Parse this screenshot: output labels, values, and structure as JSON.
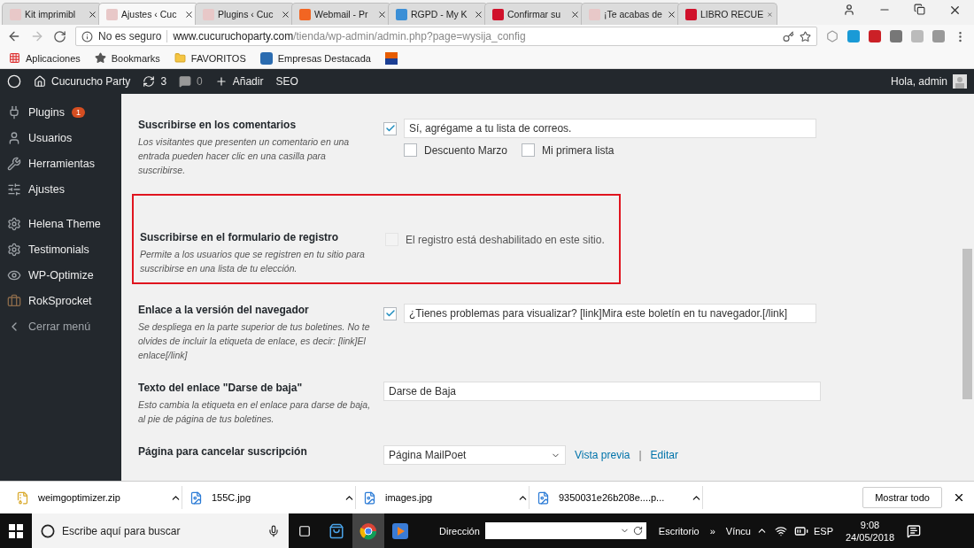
{
  "browser": {
    "tabs": [
      {
        "title": "Kit imprimibl",
        "selected": false,
        "color": "#e8c8c8"
      },
      {
        "title": "Ajustes ‹ Cuc",
        "selected": true,
        "color": "#e8c8c8"
      },
      {
        "title": "Plugins ‹ Cuc",
        "selected": false,
        "color": "#e8c8c8"
      },
      {
        "title": "Webmail - Pr",
        "selected": false,
        "color": "#f26522"
      },
      {
        "title": "RGPD - My K",
        "selected": false,
        "color": "#3b8fd6"
      },
      {
        "title": "Confirmar su",
        "selected": false,
        "color": "#d0112b"
      },
      {
        "title": "¡Te acabas de",
        "selected": false,
        "color": "#e8c8c8"
      },
      {
        "title": "LIBRO RECUE",
        "selected": false,
        "color": "#d0112b"
      }
    ],
    "security": "No es seguro",
    "url_host": "www.cucuruchoparty.com",
    "url_path": "/tienda/wp-admin/admin.php?page=wysija_config",
    "bookmarks": [
      {
        "label": "Aplicaciones",
        "kind": "apps"
      },
      {
        "label": "Bookmarks",
        "kind": "star"
      },
      {
        "label": "FAVORITOS",
        "kind": "folder"
      },
      {
        "label": "Empresas Destacada",
        "kind": "site"
      },
      {
        "kind": "flag"
      }
    ]
  },
  "admin_bar": {
    "site": "Cucurucho Party",
    "updates": "3",
    "comments": "0",
    "new": "Añadir",
    "seo": "SEO",
    "greeting": "Hola, admin"
  },
  "sidebar": {
    "items": [
      {
        "label": "Plugins",
        "badge": "1",
        "kind": "plug"
      },
      {
        "label": "Usuarios",
        "kind": "user"
      },
      {
        "label": "Herramientas",
        "kind": "wrench"
      },
      {
        "label": "Ajustes",
        "kind": "sliders"
      },
      {
        "label": "Helena Theme",
        "kind": "cog",
        "gap": true
      },
      {
        "label": "Testimonials",
        "kind": "cog"
      },
      {
        "label": "WP-Optimize",
        "kind": "eye"
      },
      {
        "label": "RokSprocket",
        "kind": "box"
      },
      {
        "label": "Cerrar menú",
        "kind": "collapse"
      }
    ]
  },
  "settings": [
    {
      "kind": "checkbox_text",
      "label": "Suscribirse en los comentarios",
      "description": "Los visitantes que presenten un comentario en una entrada pueden hacer clic en una casilla para suscribirse.",
      "checked": true,
      "value": "Sí, agrégame a tu lista de correos.",
      "lists": [
        {
          "label": "Descuento Marzo",
          "checked": false
        },
        {
          "label": "Mi primera lista",
          "checked": false
        }
      ],
      "highlighted": false
    },
    {
      "kind": "checkbox_note",
      "label": "Suscribirse en el formulario de registro",
      "description": "Permite a los usuarios que se registren en tu sitio para suscribirse en una lista de tu elección.",
      "checked": false,
      "disabled": true,
      "note": "El registro está deshabilitado en este sitio.",
      "highlighted": true
    },
    {
      "kind": "checkbox_text",
      "label": "Enlace a la versión del navegador",
      "description": "Se despliega en la parte superior de tus boletines. No te olvides de incluir la etiqueta de enlace, es decir: [link]El enlace[/link]",
      "checked": true,
      "value": "¿Tienes problemas para visualizar? [link]Mira este boletín en tu navegador.[/link]",
      "highlighted": false
    },
    {
      "kind": "text",
      "label": "Texto del enlace \"Darse de baja\"",
      "description": "Esto cambia la etiqueta en el enlace para darse de baja, al pie de página de tus boletines.",
      "value": "Darse de Baja",
      "highlighted": false
    },
    {
      "kind": "select",
      "label": "Página para cancelar suscripción",
      "value": "Página MailPoet",
      "links": [
        "Vista previa",
        "Editar"
      ],
      "separator": "|",
      "highlighted": false
    }
  ],
  "downloads": {
    "files": [
      {
        "name": "weimgoptimizer.zip",
        "kind": "zip"
      },
      {
        "name": "155C.jpg",
        "kind": "image"
      },
      {
        "name": "images.jpg",
        "kind": "image"
      },
      {
        "name": "9350031e26b208e....p...",
        "kind": "image"
      }
    ],
    "show_all": "Mostrar todo"
  },
  "taskbar": {
    "search": "Escribe aquí para buscar",
    "address_label": "Dirección",
    "toolbar": "Escritorio",
    "more": "»",
    "links": "Víncu",
    "lang": "ESP",
    "time": "9:08",
    "date": "24/05/2018"
  }
}
